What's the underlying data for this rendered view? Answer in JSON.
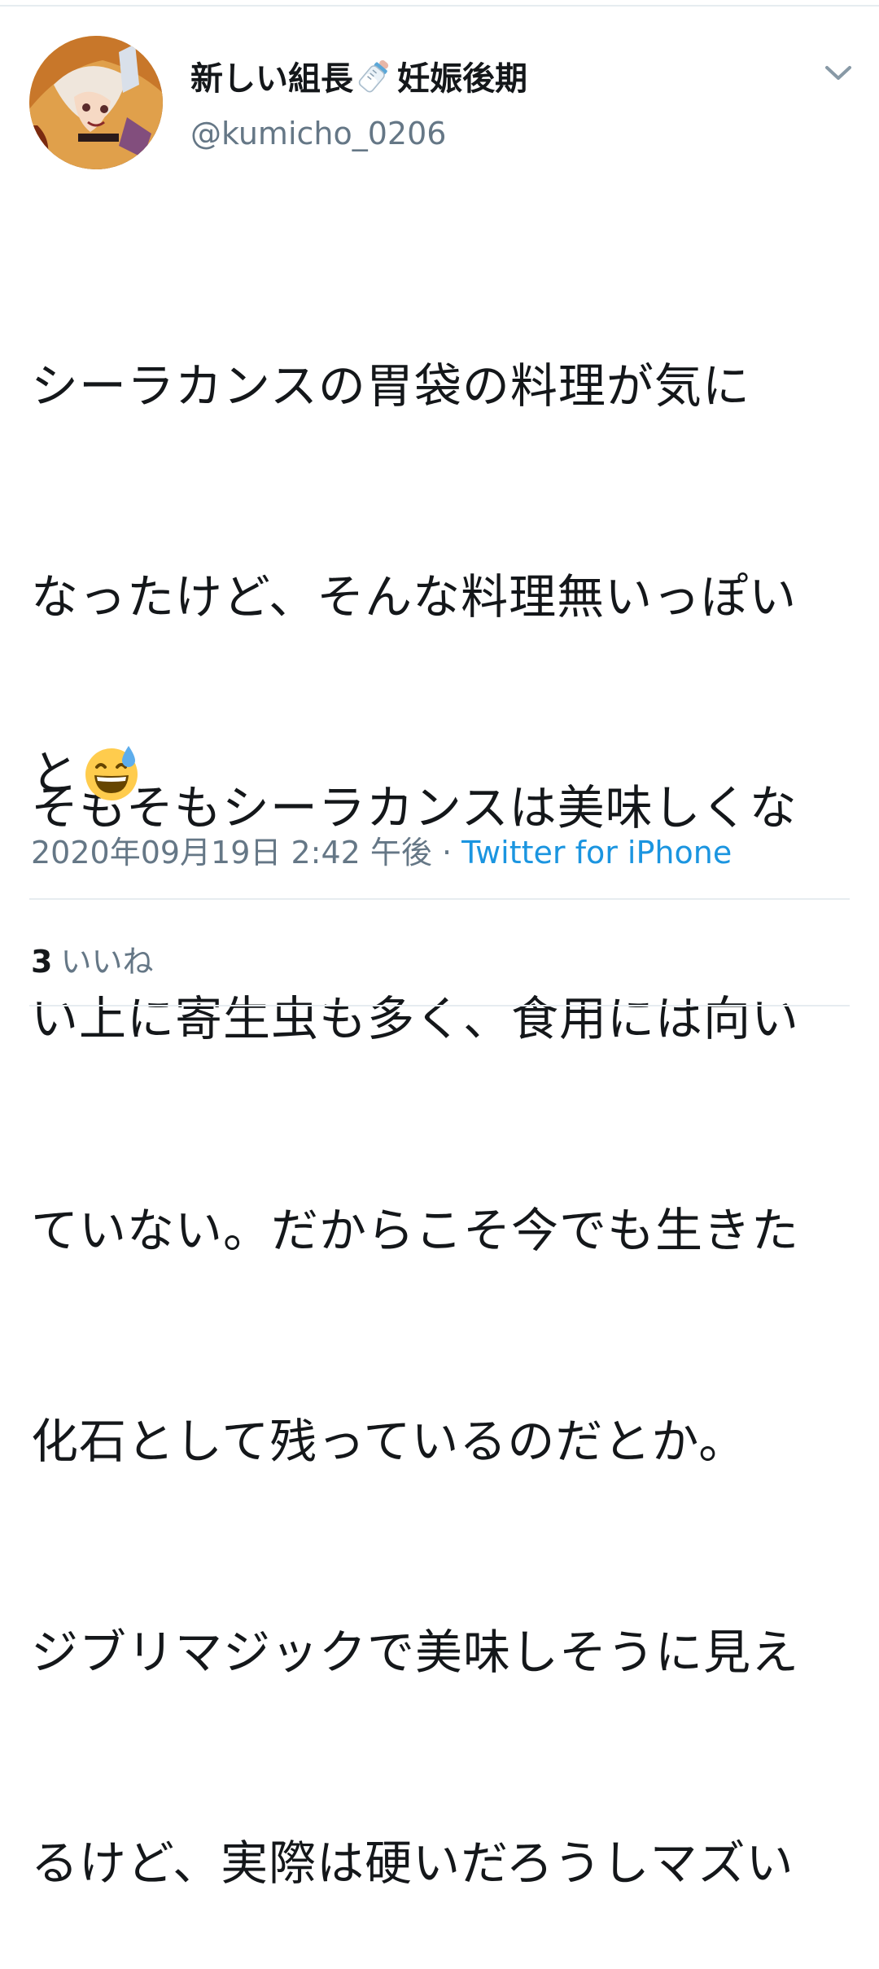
{
  "user": {
    "name_part1": "新しい組長",
    "name_emoji": "baby-bottle-icon",
    "name_part2": "妊娠後期",
    "handle": "@kumicho_0206"
  },
  "tweet": {
    "lines": [
      "シーラカンスの胃袋の料理が気に",
      "なったけど、そんな料理無いっぽい",
      "そもそもシーラカンスは美味しくな",
      "い上に寄生虫も多く、食用には向い",
      "ていない。だからこそ今でも生きた",
      "化石として残っているのだとか。",
      "ジブリマジックで美味しそうに見え",
      "るけど、実際は硬いだろうしマズい"
    ],
    "last_line": "と",
    "last_emoji": "grinning-sweat-emoji-icon"
  },
  "meta": {
    "timestamp": "2020年09月19日 2:42 午後",
    "separator": " · ",
    "source": "Twitter for iPhone"
  },
  "stats": {
    "likes_count": "3",
    "likes_label": "いいね"
  },
  "colors": {
    "text": "#14171a",
    "muted": "#657786",
    "link": "#1b95e0",
    "divider": "#e6ecf0"
  }
}
